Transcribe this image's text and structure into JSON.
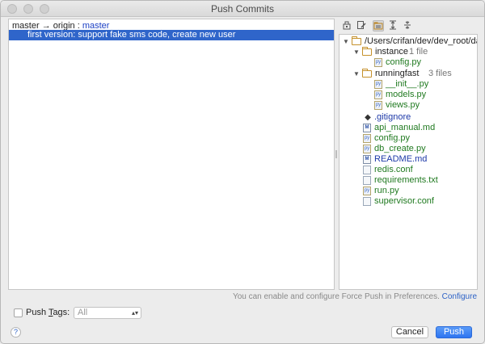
{
  "window": {
    "title": "Push Commits"
  },
  "branch": {
    "local": "master",
    "arrow": "→",
    "remote": "origin",
    "sep": ":",
    "remote_branch": "master"
  },
  "commit": {
    "message": "first version: support fake sms code, create new user"
  },
  "toolbar": {
    "icons": [
      "edit-source-icon",
      "show-diff-icon",
      "group-by-directory-icon",
      "expand-all-icon",
      "collapse-all-icon"
    ]
  },
  "tree": {
    "root": "/Users/crifan/dev/dev_root/dar",
    "folders": [
      {
        "name": "instance",
        "count": "1 file",
        "files": [
          "config.py"
        ]
      },
      {
        "name": "runningfast",
        "count": "3 files",
        "files": [
          "__init__.py",
          "models.py",
          "views.py"
        ]
      }
    ],
    "files": [
      ".gitignore",
      "api_manual.md",
      "config.py",
      "db_create.py",
      "README.md",
      "redis.conf",
      "requirements.txt",
      "run.py",
      "supervisor.conf"
    ]
  },
  "force_push": {
    "note": "You can enable and configure Force Push in Preferences.",
    "link": "Configure"
  },
  "push_tags": {
    "label_pre": "Push ",
    "label_mnemonic": "T",
    "label_post": "ags:",
    "value": "All"
  },
  "help": {
    "symbol": "?"
  },
  "buttons": {
    "cancel": "Cancel",
    "push": "Push"
  },
  "colors": {
    "selection": "#2f65ca",
    "push_button": "#2e74f0",
    "folder": "#c5912b"
  }
}
